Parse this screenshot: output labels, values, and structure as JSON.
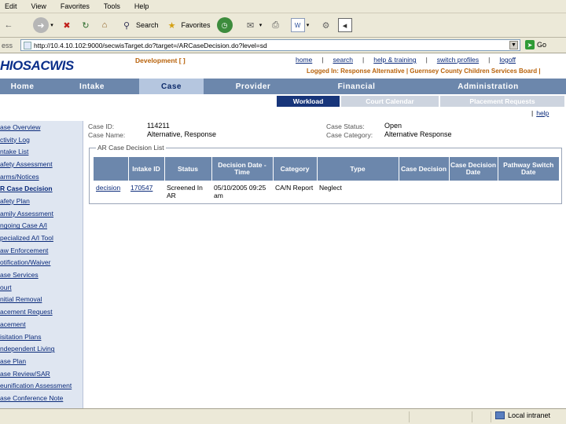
{
  "menubar": [
    "Edit",
    "View",
    "Favorites",
    "Tools",
    "Help"
  ],
  "toolbar": {
    "search_label": "Search",
    "favorites_label": "Favorites"
  },
  "address": {
    "label": "ess",
    "url": "http://10.4.10.102:9000/secwisTarget.do?target=/ARCaseDecision.do?level=sd",
    "go_label": "Go"
  },
  "header": {
    "logo": "HIOSACWIS",
    "environment": "Development [ ]",
    "toplinks": [
      "home",
      "search",
      "help & training",
      "switch profiles",
      "logoff"
    ],
    "logged_in": "Logged In:  Response Alternative | Guernsey County Children Services Board |"
  },
  "tabs": [
    "Home",
    "Intake",
    "Case",
    "Provider",
    "Financial",
    "Administration"
  ],
  "subtabs": [
    "Workload",
    "Court Calendar",
    "Placement Requests"
  ],
  "help_link": "help",
  "sidebar": [
    "ase Overview",
    "ctivity Log",
    "ntake List",
    "afety Assessment",
    "arms/Notices",
    "R Case Decision",
    "afety Plan",
    "amily Assessment",
    "ngoing Case A/I",
    "pecialized A/I Tool",
    "aw Enforcement",
    "otification/Waiver",
    "ase Services",
    "ourt",
    "nitial Removal",
    "acement Request",
    "acement",
    "isitation Plans",
    "ndependent Living",
    "ase Plan",
    "ase Review/SAR",
    "eunification Assessment",
    "ase Conference Note"
  ],
  "case_info": {
    "case_id_label": "Case ID:",
    "case_id": "114211",
    "case_name_label": "Case Name:",
    "case_name": "Alternative, Response",
    "case_status_label": "Case Status:",
    "case_status": "Open",
    "case_category_label": "Case Category:",
    "case_category": "Alternative Response"
  },
  "decision_list": {
    "legend": "AR Case Decision List",
    "columns": [
      "",
      "Intake ID",
      "Status",
      "Decision Date - Time",
      "Category",
      "Type",
      "Case Decision",
      "Case Decision Date",
      "Pathway Switch Date"
    ],
    "rows": [
      {
        "action": "decision",
        "intake_id": "170547",
        "status": "Screened In AR",
        "decision_datetime": "05/10/2005 09:25 am",
        "category": "CA/N Report",
        "type": "Neglect",
        "case_decision": "",
        "case_decision_date": "",
        "pathway_switch_date": ""
      }
    ]
  },
  "status": {
    "zone": "Local intranet"
  }
}
